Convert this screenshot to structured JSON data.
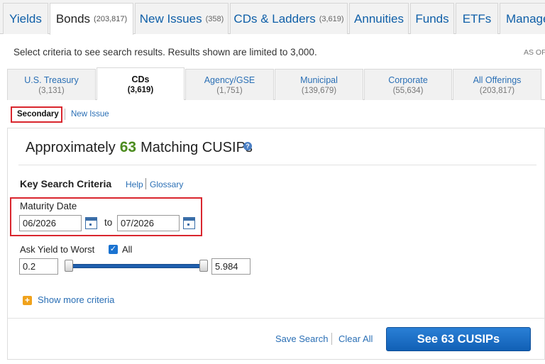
{
  "top_tabs": [
    {
      "label": "Yields",
      "count": ""
    },
    {
      "label": "Bonds",
      "count": "(203,817)"
    },
    {
      "label": "New Issues",
      "count": "(358)"
    },
    {
      "label": "CDs & Ladders",
      "count": "(3,619)"
    },
    {
      "label": "Annuities",
      "count": ""
    },
    {
      "label": "Funds",
      "count": ""
    },
    {
      "label": "ETFs",
      "count": ""
    },
    {
      "label": "Manage",
      "count": ""
    }
  ],
  "notice": "Select criteria to see search results. Results shown are limited to 3,000.",
  "as_of": "AS OF",
  "sub_tabs": [
    {
      "label": "U.S. Treasury",
      "count": "(3,131)"
    },
    {
      "label": "CDs",
      "count": "(3,619)"
    },
    {
      "label": "Agency/GSE",
      "count": "(1,751)"
    },
    {
      "label": "Municipal",
      "count": "(139,679)"
    },
    {
      "label": "Corporate",
      "count": "(55,634)"
    },
    {
      "label": "All Offerings",
      "count": "(203,817)"
    }
  ],
  "mode": {
    "secondary": "Secondary",
    "new_issue": "New Issue"
  },
  "results": {
    "prefix": "Approximately",
    "count": "63",
    "suffix": "Matching CUSIPs",
    "help_icon": "question-icon"
  },
  "criteria": {
    "title": "Key Search Criteria",
    "help": "Help",
    "glossary": "Glossary",
    "maturity_label": "Maturity Date",
    "maturity_from": "06/2026",
    "to": "to",
    "maturity_to": "07/2026",
    "yield_label": "Ask Yield to Worst",
    "all_label": "All",
    "all_checked": true,
    "yield_min": "0.2",
    "yield_max": "5.984",
    "more": "Show more criteria"
  },
  "actions": {
    "save": "Save Search",
    "clear": "Clear All",
    "see": "See 63 CUSIPs"
  },
  "colors": {
    "accent": "#1f5fae",
    "highlight": "#d9262e",
    "count_green": "#4c8c1f",
    "more_icon": "#f0a21c"
  }
}
